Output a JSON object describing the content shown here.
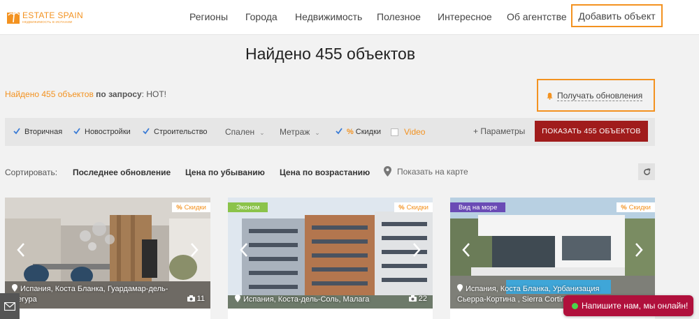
{
  "header": {
    "logo_brand": "ESTATE SPAIN",
    "logo_tagline": "НЕДВИЖИМОСТЬ В ИСПАНИИ",
    "nav": [
      "Регионы",
      "Города",
      "Недвижимость",
      "Полезное",
      "Интересное",
      "Об агентстве"
    ],
    "add_button": "Добавить объект"
  },
  "title": "Найдено 455 объектов",
  "summary": {
    "found": "Найдено 455 объектов",
    "by_query": "по запросу",
    "query": ": HOT!"
  },
  "subscribe": "Получать обновления",
  "filters": {
    "checks": [
      "Вторичная",
      "Новостройки",
      "Строительство"
    ],
    "bedrooms": "Спален",
    "area": "Метраж",
    "discount_symbol": "%",
    "discount_label": "Скидки",
    "video": "Video",
    "params": "+ Параметры",
    "show_button": "ПОКАЗАТЬ 455 ОБЪЕКТОВ"
  },
  "sort": {
    "label": "Сортировать:",
    "options": [
      "Последнее обновление",
      "Цена по убыванию",
      "Цена по возрастанию"
    ],
    "map": "Показать на карте"
  },
  "cards": [
    {
      "discount": "Скидки",
      "tag": "",
      "location_1": "Испания,  Коста Бланка, Гуардамар-дель-",
      "location_2": "Сегура",
      "photos": "11"
    },
    {
      "discount": "Скидки",
      "tag": "Эконом",
      "location_1": "Испания,  Коста-дель-Соль, Малага",
      "location_2": "",
      "photos": "22"
    },
    {
      "discount": "Скидки",
      "tag": "Вид на море",
      "location_1": "Испания,  Коста Бланка, Урбанизация",
      "location_2": "Сьерра-Кортина , Sierra Cortina",
      "photos": ""
    }
  ],
  "chat": "Напишите нам, мы онлайн!",
  "colors": {
    "accent": "#f39220",
    "button": "#a01c1c",
    "chat": "#b0103c",
    "tag_econom": "#8bc34a",
    "tag_sea": "#6a4bb5"
  }
}
